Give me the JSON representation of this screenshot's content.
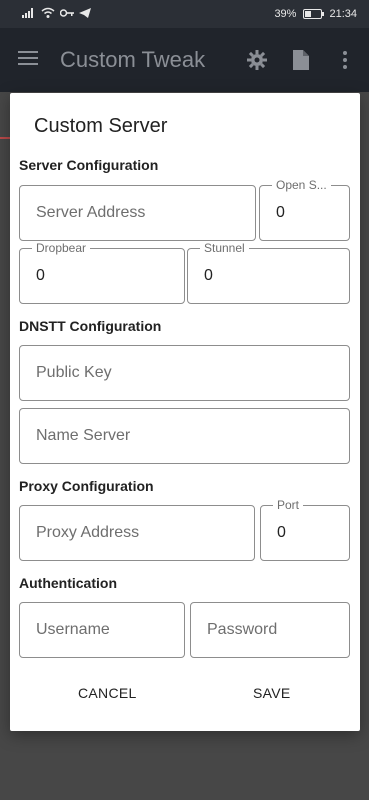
{
  "status_bar": {
    "signal": "signal-icon",
    "wifi": "wifi-icon",
    "key": "key-icon",
    "telegram": "telegram-icon",
    "battery_text": "39%",
    "battery_level": 0.39,
    "time": "21:34"
  },
  "app_bar": {
    "title": "Custom Tweak"
  },
  "dialog": {
    "title": "Custom Server",
    "sections": {
      "server": "Server Configuration",
      "dnstt": "DNSTT Configuration",
      "proxy": "Proxy Configuration",
      "auth": "Authentication"
    },
    "fields": {
      "server_address": {
        "placeholder": "Server Address",
        "value": ""
      },
      "open_ssh": {
        "label": "Open S...",
        "value": "0"
      },
      "dropbear": {
        "label": "Dropbear",
        "value": "0"
      },
      "stunnel": {
        "label": "Stunnel",
        "value": "0"
      },
      "public_key": {
        "placeholder": "Public Key",
        "value": ""
      },
      "name_server": {
        "placeholder": "Name Server",
        "value": ""
      },
      "proxy_address": {
        "placeholder": "Proxy Address",
        "value": ""
      },
      "port": {
        "label": "Port",
        "value": "0"
      },
      "username": {
        "placeholder": "Username",
        "value": ""
      },
      "password": {
        "placeholder": "Password",
        "value": ""
      }
    },
    "buttons": {
      "cancel": "CANCEL",
      "save": "SAVE"
    }
  },
  "colors": {
    "status_bar_bg": "#2b2f36",
    "app_bar_bg": "#20242b",
    "scrim": "#474747",
    "dialog_bg": "#ffffff",
    "field_border": "#8d8d8d"
  }
}
